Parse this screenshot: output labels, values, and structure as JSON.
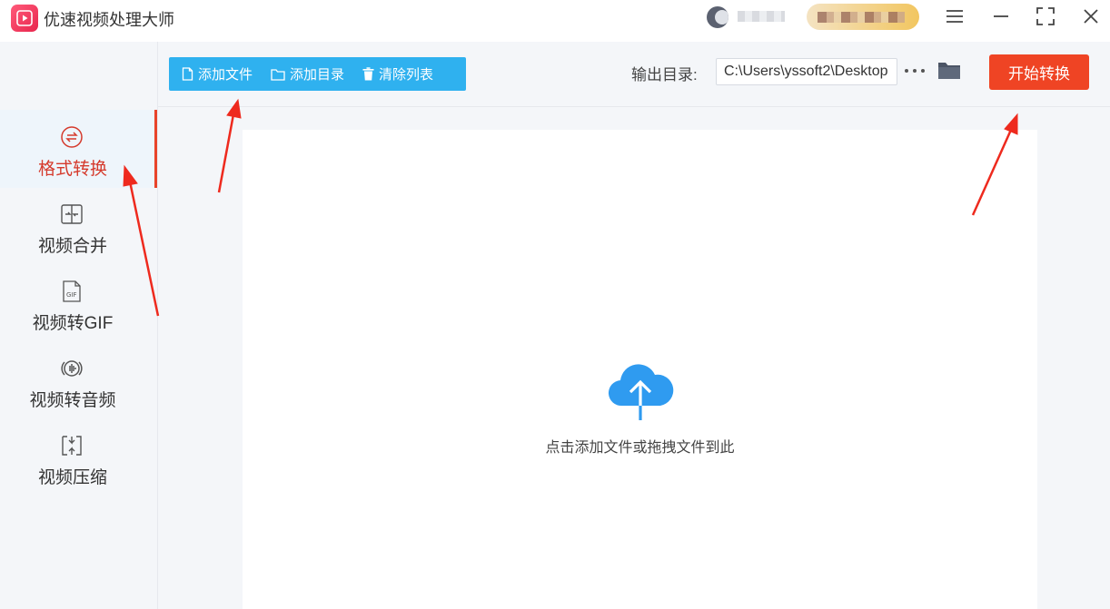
{
  "app": {
    "title": "优速视频处理大师",
    "accent_color": "#ef4424",
    "primary_color": "#2fb1ef"
  },
  "window_controls": [
    {
      "icon": "menu-icon"
    },
    {
      "icon": "minimize-icon"
    },
    {
      "icon": "maximize-icon"
    },
    {
      "icon": "close-icon"
    }
  ],
  "sidebar": {
    "items": [
      {
        "label": "格式转换",
        "icon": "format-convert-icon",
        "active": true
      },
      {
        "label": "视频合并",
        "icon": "merge-icon",
        "active": false
      },
      {
        "label": "视频转GIF",
        "icon": "gif-file-icon",
        "active": false
      },
      {
        "label": "视频转音频",
        "icon": "audio-wave-icon",
        "active": false
      },
      {
        "label": "视频压缩",
        "icon": "compress-icon",
        "active": false
      }
    ]
  },
  "toolbar": {
    "add_file": "添加文件",
    "add_folder": "添加目录",
    "clear_list": "清除列表",
    "output_label": "输出目录:",
    "output_path": "C:\\Users\\yssoft2\\Desktop",
    "start_button": "开始转换"
  },
  "drop_area": {
    "hint": "点击添加文件或拖拽文件到此",
    "icon": "cloud-upload-icon"
  }
}
